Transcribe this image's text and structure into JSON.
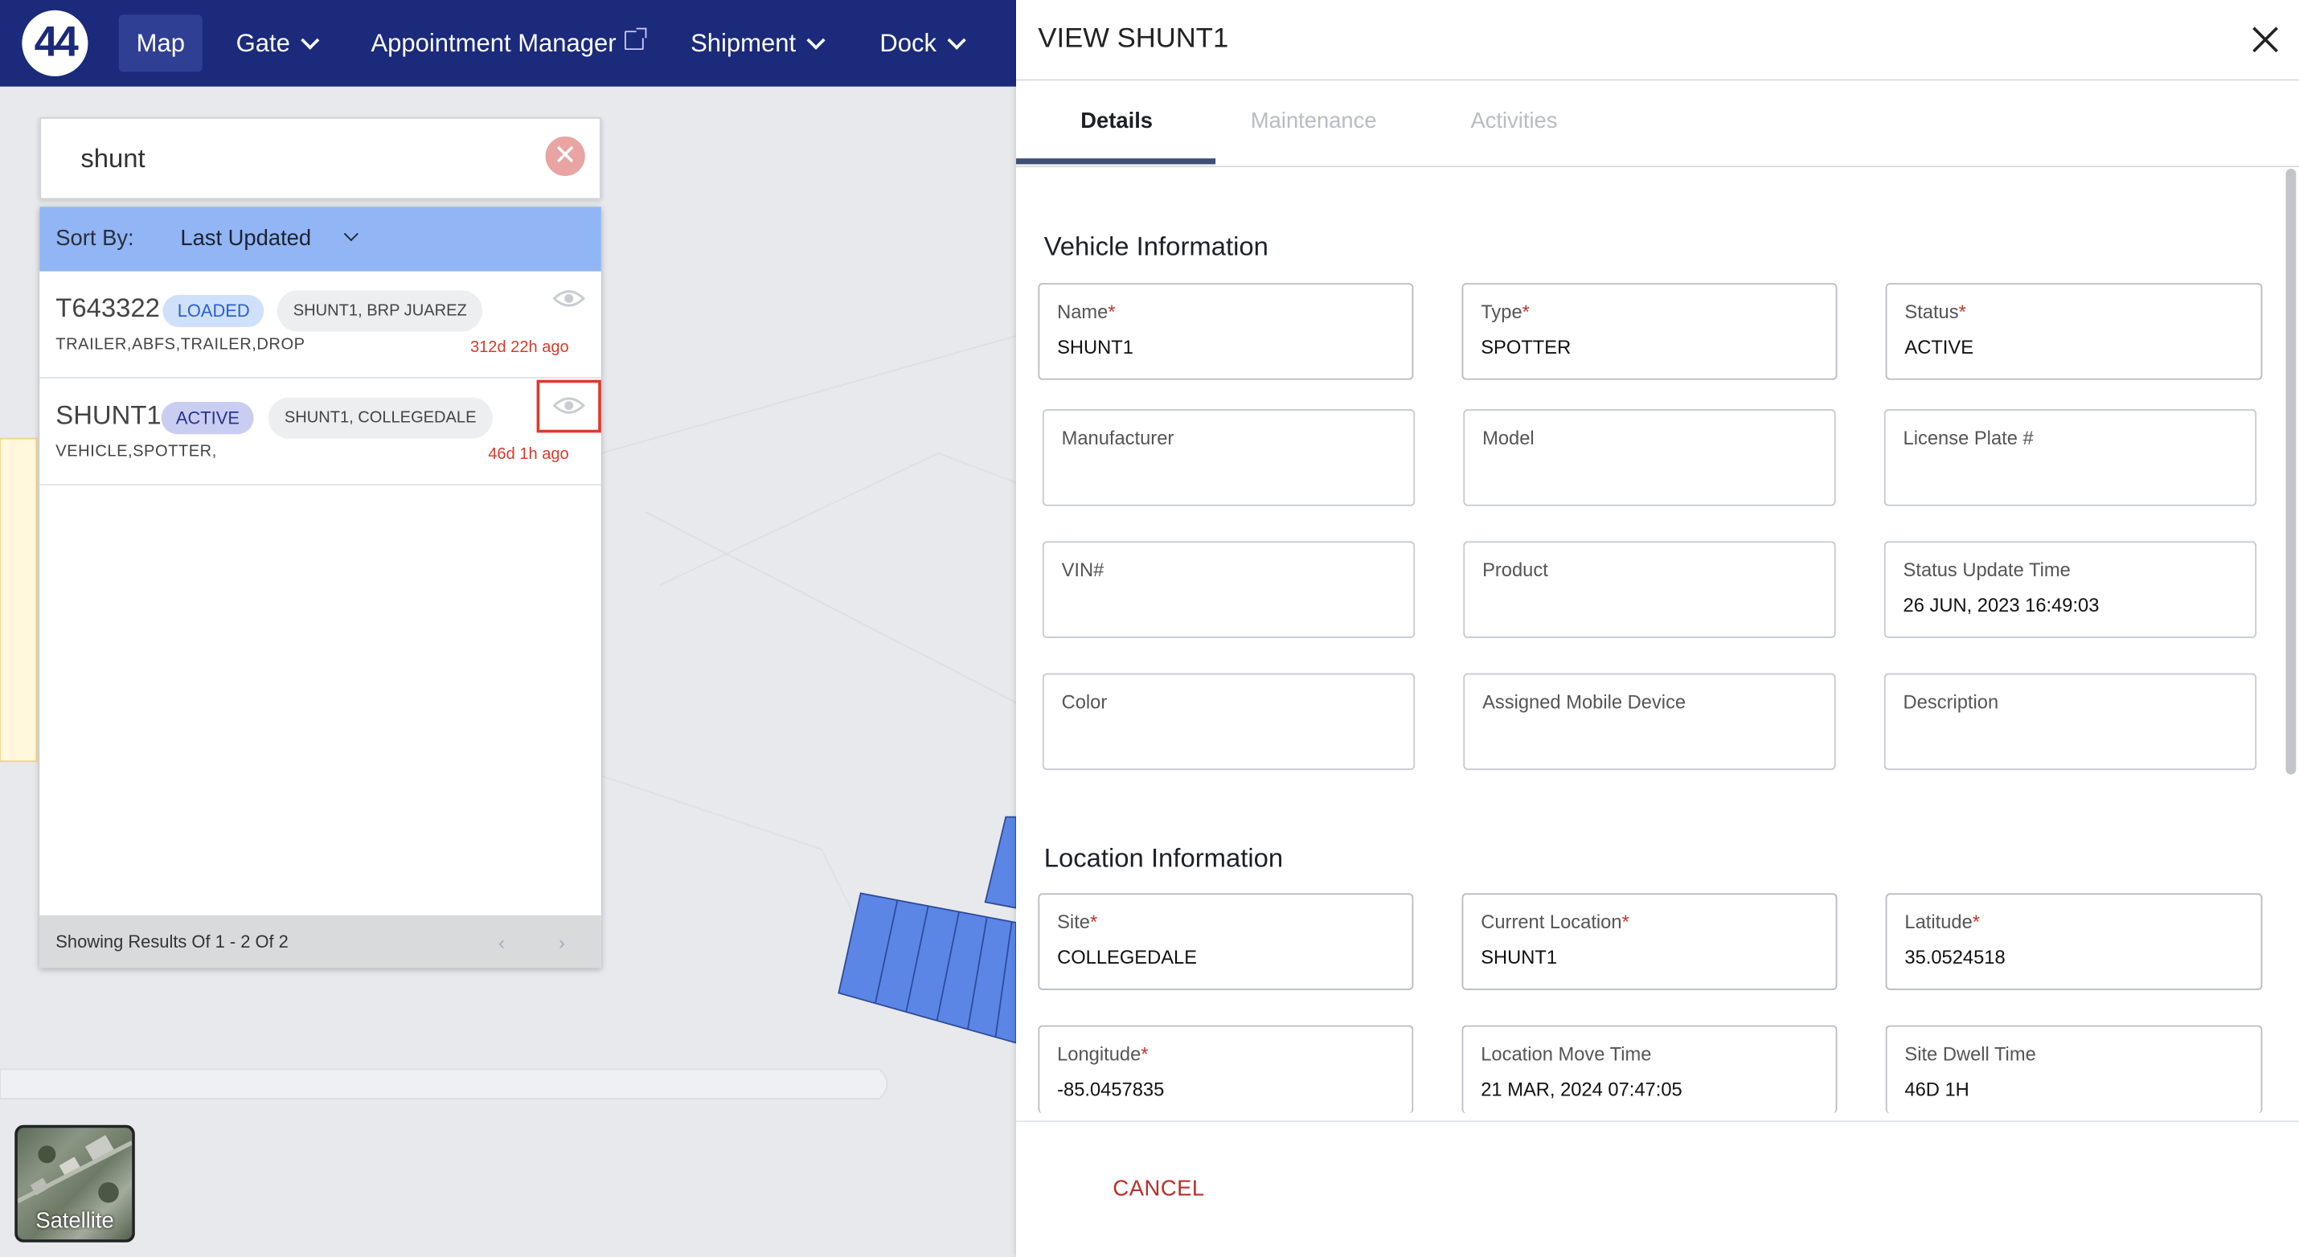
{
  "nav": {
    "logo": "44",
    "items": [
      "Map",
      "Gate",
      "Appointment Manager",
      "Shipment",
      "Dock"
    ]
  },
  "search": {
    "query": "shunt"
  },
  "sort": {
    "label": "Sort By:",
    "value": "Last Updated"
  },
  "results": [
    {
      "code": "T643322",
      "status": "LOADED",
      "location": "SHUNT1, BRP JUAREZ",
      "tags": "TRAILER,ABFS,TRAILER,DROP",
      "ago": "312d 22h ago"
    },
    {
      "code": "SHUNT1",
      "status": "ACTIVE",
      "location": "SHUNT1, COLLEGEDALE",
      "tags": "VEHICLE,SPOTTER,",
      "ago": "46d 1h ago"
    }
  ],
  "pagination": {
    "text": "Showing Results Of 1 - 2 Of 2",
    "prev": "‹",
    "next": "›"
  },
  "satellite": {
    "label": "Satellite"
  },
  "drawer": {
    "title": "VIEW SHUNT1",
    "tabs": [
      "Details",
      "Maintenance",
      "Activities"
    ],
    "vehicle_section": "Vehicle Information",
    "vehicle_fields": [
      {
        "label": "Name",
        "required": true,
        "value": "SHUNT1"
      },
      {
        "label": "Type",
        "required": true,
        "value": "SPOTTER"
      },
      {
        "label": "Status",
        "required": true,
        "value": "ACTIVE"
      },
      {
        "label": "Manufacturer",
        "required": false,
        "value": ""
      },
      {
        "label": "Model",
        "required": false,
        "value": ""
      },
      {
        "label": "License Plate #",
        "required": false,
        "value": ""
      },
      {
        "label": "VIN#",
        "required": false,
        "value": ""
      },
      {
        "label": "Product",
        "required": false,
        "value": ""
      },
      {
        "label": "Status Update Time",
        "required": false,
        "value": "26 JUN, 2023 16:49:03"
      },
      {
        "label": "Color",
        "required": false,
        "value": ""
      },
      {
        "label": "Assigned Mobile Device",
        "required": false,
        "value": ""
      },
      {
        "label": "Description",
        "required": false,
        "value": ""
      }
    ],
    "location_section": "Location Information",
    "location_fields": [
      {
        "label": "Site",
        "required": true,
        "value": "COLLEGEDALE"
      },
      {
        "label": "Current Location",
        "required": true,
        "value": "SHUNT1"
      },
      {
        "label": "Latitude",
        "required": true,
        "value": "35.0524518"
      },
      {
        "label": "Longitude",
        "required": true,
        "value": "-85.0457835"
      },
      {
        "label": "Location Move Time",
        "required": false,
        "value": "21 MAR, 2024 07:47:05"
      },
      {
        "label": "Site Dwell Time",
        "required": false,
        "value": "46D 1H"
      }
    ],
    "cancel_label": "CANCEL"
  },
  "colors": {
    "nav_bg": "#1b2a7a",
    "sort_bar": "#92b5f5",
    "danger": "#d93a2b",
    "parking_blue": "#5b86e6"
  }
}
